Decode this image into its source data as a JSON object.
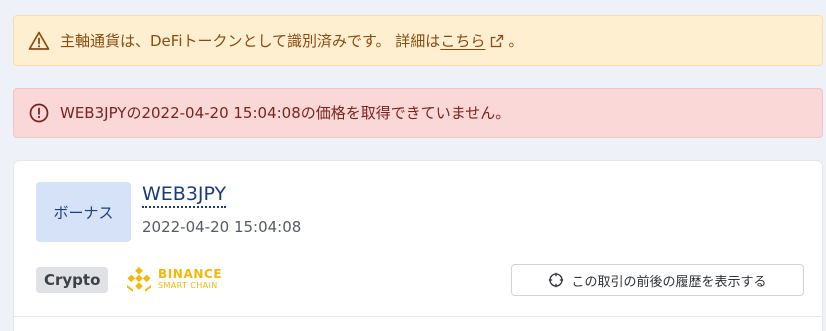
{
  "warning_alert": {
    "text": "主軸通貨は、DeFiトークンとして識別済みです。 詳細は",
    "link_text": "こちら",
    "suffix": "。",
    "icon": "warning-triangle-icon"
  },
  "error_alert": {
    "text": "WEB3JPYの2022-04-20 15:04:08の価格を取得できていません。",
    "icon": "exclamation-circle-icon"
  },
  "transaction": {
    "type_label": "ボーナス",
    "token_name": "WEB3JPY",
    "date": "2022-04-20 15:04:08",
    "category": "Crypto",
    "chain": {
      "line1": "BINANCE",
      "line2": "SMART CHAIN",
      "color": "#f0b90b"
    },
    "history_button_label": "この取引の前後の履歴を表示する"
  },
  "colors": {
    "warning_bg": "#fdefd0",
    "error_bg": "#f9d8d7",
    "badge_bg": "#d6e2f7"
  }
}
